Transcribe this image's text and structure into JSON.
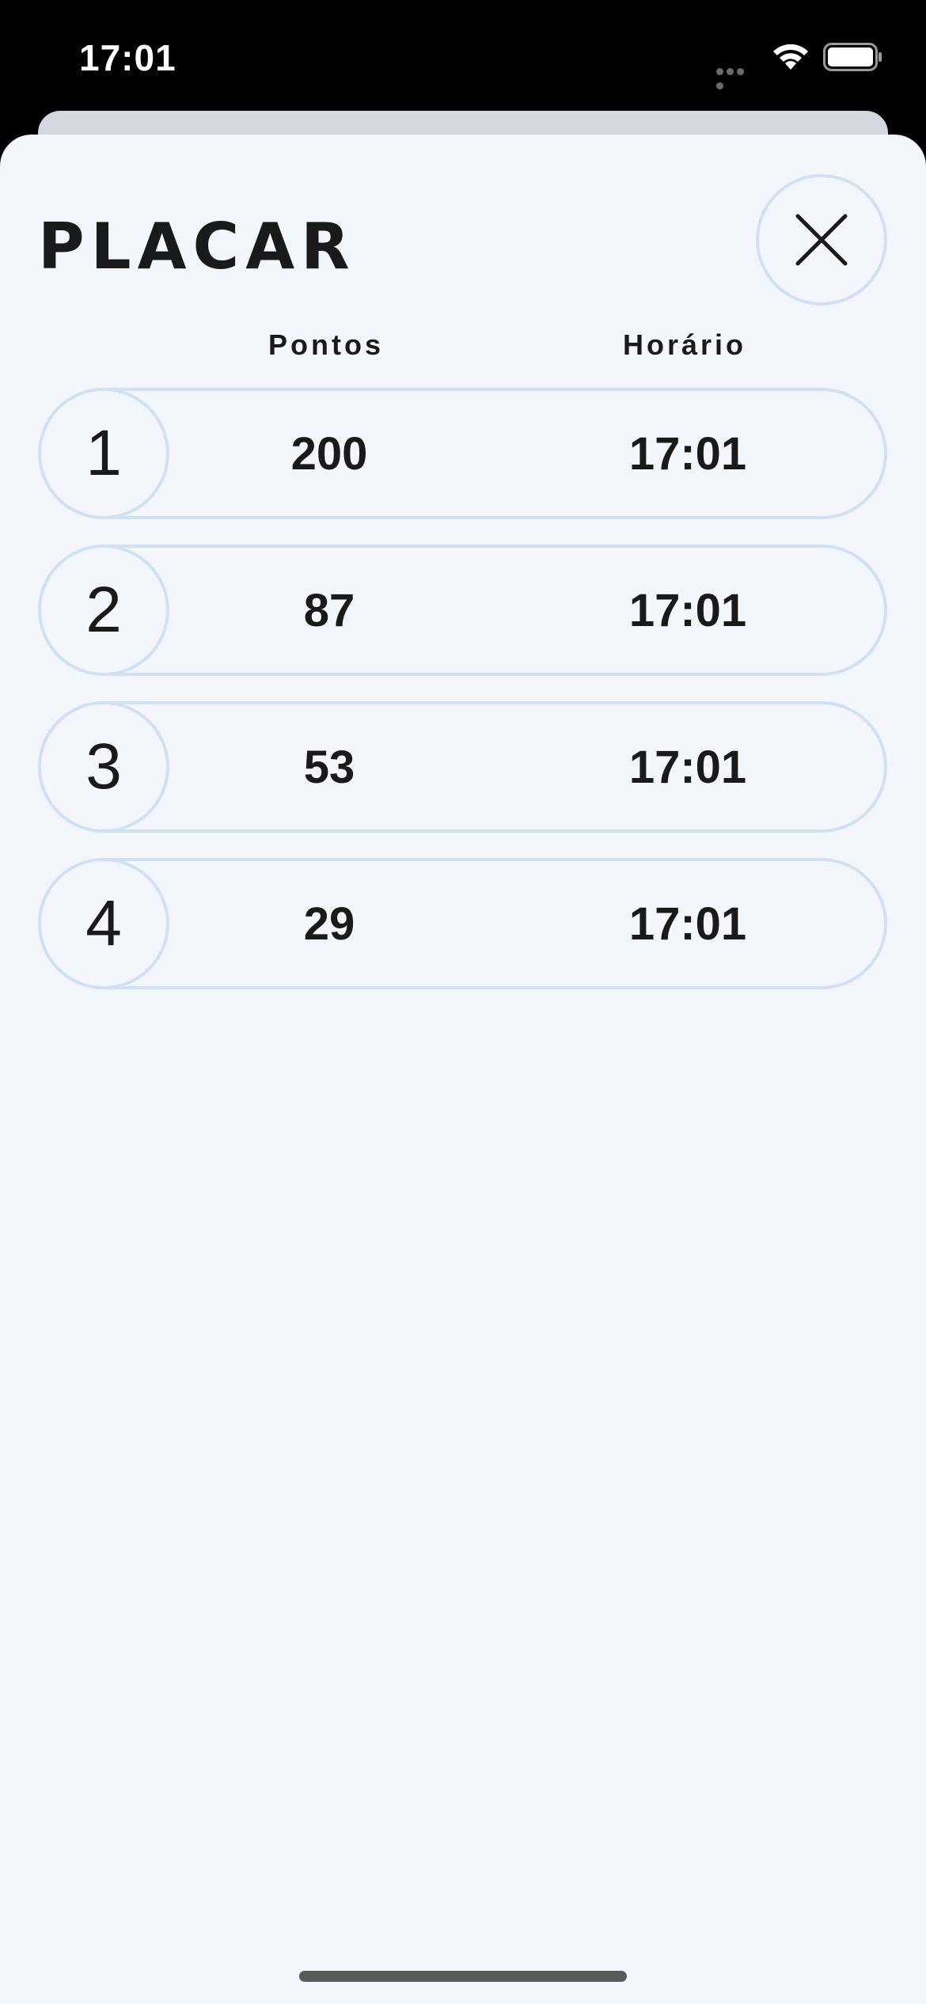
{
  "status_bar": {
    "time": "17:01"
  },
  "sheet": {
    "title": "PLACAR",
    "headers": {
      "points": "Pontos",
      "time": "Horário"
    }
  },
  "scores": [
    {
      "rank": "1",
      "points": "200",
      "time": "17:01"
    },
    {
      "rank": "2",
      "points": "87",
      "time": "17:01"
    },
    {
      "rank": "3",
      "points": "53",
      "time": "17:01"
    },
    {
      "rank": "4",
      "points": "29",
      "time": "17:01"
    }
  ],
  "colors": {
    "sheet_background": "#f3f7fc",
    "outline": "#cfe1f5",
    "text": "#1a1a1a"
  },
  "icons": {
    "close": "close-icon",
    "wifi": "wifi-icon",
    "battery": "battery-icon",
    "cellular": "cellular-dots-icon"
  }
}
